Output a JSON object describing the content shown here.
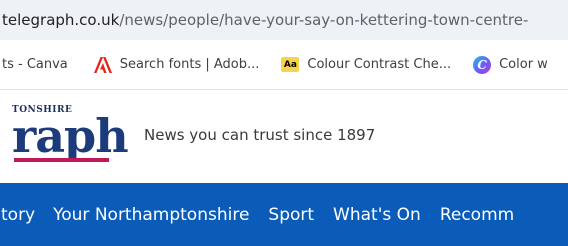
{
  "url_bar": {
    "domain": "telegraph.co.uk",
    "path": "/news/people/have-your-say-on-kettering-town-centre-"
  },
  "bookmarks": [
    {
      "label": "ts - Canva",
      "icon": "none"
    },
    {
      "label": "Search fonts | Adob...",
      "icon": "adobe-icon",
      "color": "#e4261c"
    },
    {
      "label": "Colour Contrast Che...",
      "icon": "aa-icon",
      "icon_text": "Aa",
      "color": "#f6d34a"
    },
    {
      "label": "Color w",
      "icon": "color-wheel-icon",
      "icon_text": "C",
      "color": "#6a5cf6"
    }
  ],
  "masthead": {
    "logo_county": "TONSHIRE",
    "logo_word": "raph",
    "logo_color": "#1c3b7a",
    "underline_color": "#c2185b",
    "tagline": "News you can trust since 1897"
  },
  "nav": {
    "background": "#0a5cb8",
    "items": [
      "tory",
      "Your Northamptonshire",
      "Sport",
      "What's On",
      "Recomm"
    ]
  }
}
